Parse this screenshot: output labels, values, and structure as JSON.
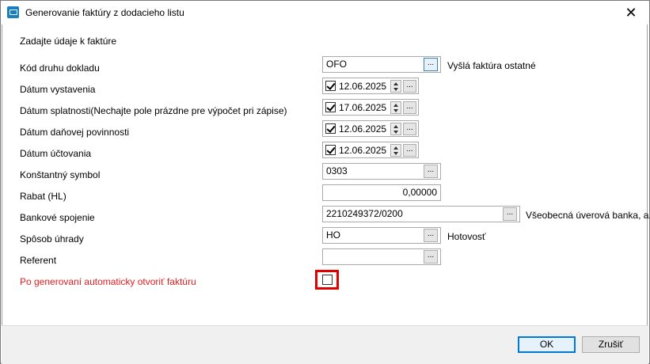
{
  "window": {
    "title": "Generovanie faktúry z dodacieho listu",
    "close_glyph": "✕"
  },
  "section_title": "Zadajte údaje k faktúre",
  "fields": {
    "kod_druhu": {
      "label": "Kód druhu dokladu",
      "value": "OFO",
      "description": "Vyšlá faktúra ostatné",
      "button": "..."
    },
    "datum_vystavenia": {
      "label": "Dátum vystavenia",
      "value": "12.06.2025",
      "checked": true,
      "button": "..."
    },
    "datum_splatnosti": {
      "label": "Dátum splatnosti(Nechajte pole prázdne pre výpočet pri zápise)",
      "value": "17.06.2025",
      "checked": true,
      "button": "..."
    },
    "datum_danovej": {
      "label": "Dátum daňovej povinnosti",
      "value": "12.06.2025",
      "checked": true,
      "button": "..."
    },
    "datum_uctovania": {
      "label": "Dátum účtovania",
      "value": "12.06.2025",
      "checked": true,
      "button": "..."
    },
    "konstantny_symbol": {
      "label": "Konštantný symbol",
      "value": "0303",
      "button": "..."
    },
    "rabat": {
      "label": "Rabat (HL)",
      "value": "0,00000"
    },
    "bankove_spojenie": {
      "label": "Bankové spojenie",
      "value": "2210249372/0200",
      "description": "Všeobecná úverová banka, a.s.",
      "button": "..."
    },
    "sposob_uhrady": {
      "label": "Spôsob úhrady",
      "value": "HO",
      "description": "Hotovosť",
      "button": "..."
    },
    "referent": {
      "label": "Referent",
      "value": "",
      "button": "..."
    },
    "auto_open": {
      "label": "Po generovaní automaticky otvoriť faktúru",
      "checked": false
    }
  },
  "buttons": {
    "ok": "OK",
    "cancel": "Zrušiť"
  },
  "colors": {
    "accent": "#0078d7",
    "highlight": "#e00000",
    "warning_label": "#e02020"
  }
}
